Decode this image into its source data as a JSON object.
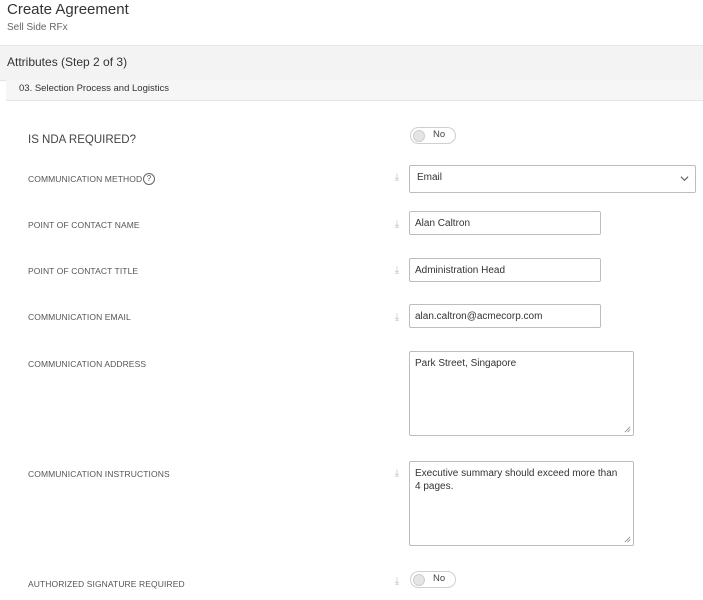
{
  "header": {
    "title": "Create Agreement",
    "subtitle": "Sell Side RFx"
  },
  "step": {
    "label": "Attributes (Step 2 of 3)"
  },
  "section": {
    "label": "03. Selection Process and Logistics"
  },
  "fields": {
    "nda_required": {
      "label": "IS NDA REQUIRED?",
      "value": "No"
    },
    "communication_method": {
      "label": "COMMUNICATION METHOD",
      "value": "Email",
      "help_icon": "question-circle-icon"
    },
    "contact_name": {
      "label": "POINT OF CONTACT NAME",
      "value": "Alan Caltron"
    },
    "contact_title": {
      "label": "POINT OF CONTACT TITLE",
      "value": "Administration Head"
    },
    "communication_email": {
      "label": "COMMUNICATION EMAIL",
      "value": "alan.caltron@acmecorp.com"
    },
    "communication_address": {
      "label": "COMMUNICATION ADDRESS",
      "value": "Park Street, Singapore"
    },
    "communication_instructions": {
      "label": "COMMUNICATION INSTRUCTIONS",
      "value": "Executive summary should exceed more than 4 pages."
    },
    "authorized_signature": {
      "label": "AUTHORIZED SIGNATURE REQUIRED",
      "value": "No"
    }
  }
}
